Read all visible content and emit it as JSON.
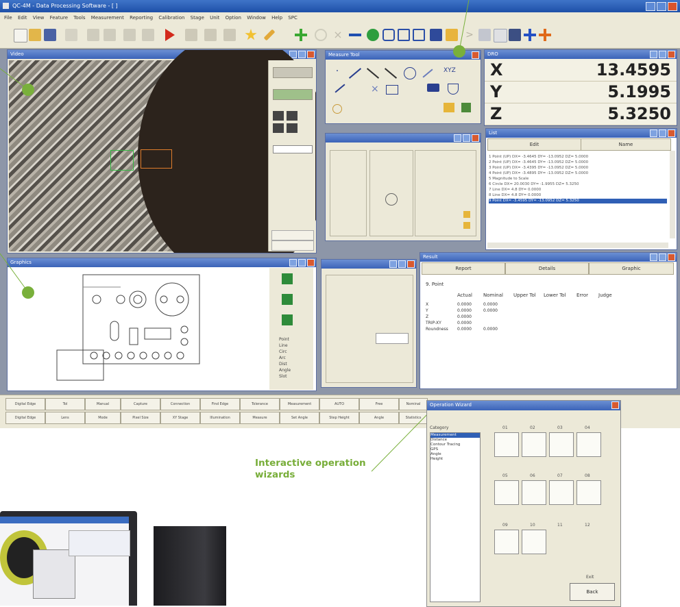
{
  "app": {
    "title": "QC-4M - Data Processing Software - [ ]",
    "menu": [
      "File",
      "Edit",
      "View",
      "Feature",
      "Tools",
      "Measurement",
      "Reporting",
      "Calibration",
      "Stage",
      "Unit",
      "Option",
      "Window",
      "Help",
      "SPC"
    ]
  },
  "dro": {
    "title": "DRO",
    "axes": [
      {
        "label": "X",
        "value": "13.4595"
      },
      {
        "label": "Y",
        "value": "5.1995"
      },
      {
        "label": "Z",
        "value": "5.3250"
      }
    ]
  },
  "video": {
    "title": "Video"
  },
  "measure_tool": {
    "title": "Measure Tool"
  },
  "list": {
    "title": "List",
    "columns": [
      "Edit",
      "Name"
    ],
    "rows": [
      "1 Point (UP)              DX= -3.4645  DY= -13.0952  DZ= 5.0000",
      "2 Point (UP)              DX= -3.4645  DY= -13.0952  DZ= 5.0000",
      "3 Point (UP)              DX= -3.4395  DY= -13.0952  DZ= 5.0000",
      "4 Point (UP)              DX= -3.4895  DY= -13.0952  DZ= 5.0000",
      "5 Magnitude to Scale",
      "6 Circle                  DX= 20.0030  DY= -1.9955  DZ= 5.3250",
      "7 Line                    DX= 4.8    DY= 0.0000",
      "8 Line                    DX= 4.8    DY= 0.0000",
      "9 Point                   DX= -3.4595  DY= -13.0952  DZ= 5.3250"
    ]
  },
  "graphics": {
    "title": "Graphics",
    "side_items": [
      "Point",
      "Line",
      "Circ",
      "Arc",
      "Dist",
      "Angle",
      "Slot"
    ]
  },
  "result": {
    "title": "Result",
    "tabs": [
      "Report",
      "Details",
      "Graphic"
    ],
    "feature": "9. Point",
    "headers": [
      "Actual",
      "Nominal",
      "Upper Tol",
      "Lower Tol",
      "Error",
      "Judge"
    ],
    "rows": [
      {
        "label": "X",
        "actual": "0.0000",
        "nominal": "0.0000"
      },
      {
        "label": "Y",
        "actual": "0.0000",
        "nominal": "0.0000"
      },
      {
        "label": "Z",
        "actual": "0.0000",
        "nominal": ""
      },
      {
        "label": "TRIP-XY",
        "actual": "0.0000",
        "nominal": ""
      },
      {
        "label": "Roundness",
        "actual": "0.0000",
        "nominal": "0.0000"
      }
    ]
  },
  "statusbar": {
    "row1": [
      "Digital Edge",
      "Tol",
      "Manual",
      "Capture",
      "Connection",
      "Find Edge",
      "Tolerance",
      "Measurement",
      "AUTO",
      "Free",
      "Nominal"
    ],
    "row2": [
      "Digital Edge",
      "Lens",
      "Mode",
      "Pixel Size",
      "XY Stage",
      "Illumination",
      "Measure",
      "Set Angle",
      "Step Height",
      "Angle",
      "Statistics"
    ]
  },
  "wizard": {
    "title": "Operation Wizard",
    "category_label": "Category",
    "categories": [
      "Measurement",
      "Distance",
      "Contour Tracing",
      "GPS",
      "Angle",
      "Height"
    ],
    "icon_headers": [
      "01",
      "02",
      "03",
      "04",
      "05",
      "06",
      "07",
      "08",
      "09",
      "10",
      "11",
      "12"
    ],
    "exit_label": "Exit",
    "back_label": "Back"
  },
  "annotations": {
    "interactive_wizards": "Interactive operation wizards"
  },
  "colors": {
    "accent": "#77ad38",
    "titlebar": "#2e5fb8",
    "selected": "#2f5fb5"
  }
}
